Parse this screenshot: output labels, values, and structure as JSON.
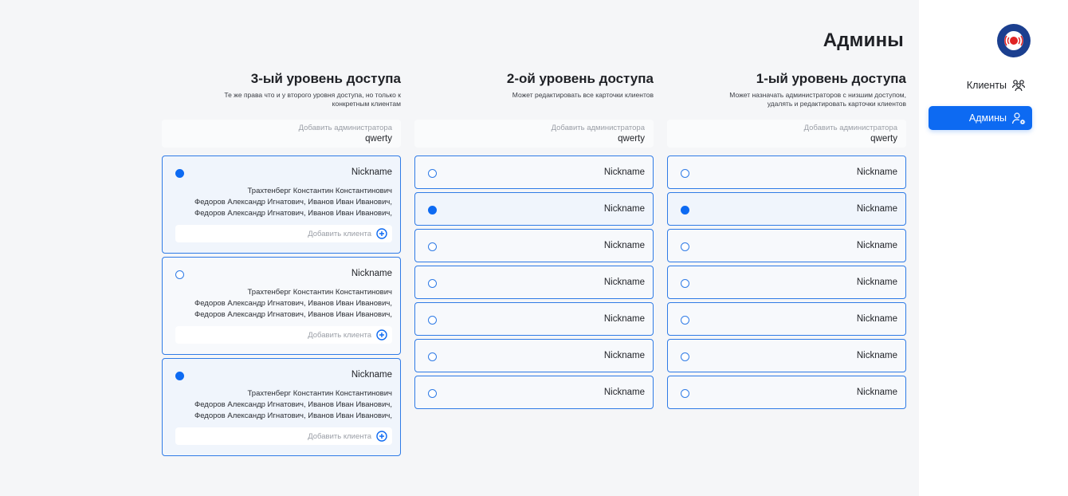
{
  "page": {
    "title": "Админы"
  },
  "nav": {
    "clients_label": "Клиенты",
    "admins_label": "Админы"
  },
  "colors": {
    "accent": "#0d6af2",
    "card_border": "#2f7be6",
    "background": "#f5f6f8"
  },
  "columns": [
    {
      "title": "3-ый уровень доступа",
      "desc_line1": "Те же права что и у второго уровня доступа, но только к",
      "desc_line2": "конкретным клиентам",
      "add_label": "Добавить администратора",
      "add_value": "qwerty",
      "cards": [
        {
          "nickname": "Nickname",
          "selected": true,
          "line1": "Трахтенберг Константин Константинович",
          "line2": "Федоров Александр Игнатович, Иванов Иван Иванович,",
          "line3": "Федоров Александр Игнатович, Иванов Иван Иванович,",
          "add_client": "Добавить клиента"
        },
        {
          "nickname": "Nickname",
          "selected": false,
          "line1": "Трахтенберг Константин Константинович",
          "line2": "Федоров Александр Игнатович, Иванов Иван Иванович,",
          "line3": "Федоров Александр Игнатович, Иванов Иван Иванович,",
          "add_client": "Добавить клиента"
        },
        {
          "nickname": "Nickname",
          "selected": true,
          "line1": "Трахтенберг Константин Константинович",
          "line2": "Федоров Александр Игнатович, Иванов Иван Иванович,",
          "line3": "Федоров Александр Игнатович, Иванов Иван Иванович,",
          "add_client": "Добавить клиента"
        }
      ]
    },
    {
      "title": "2-ой уровень доступа",
      "desc_line1": "Может редактировать все карточки клиентов",
      "desc_line2": "",
      "add_label": "Добавить администратора",
      "add_value": "qwerty",
      "cards": [
        {
          "nickname": "Nickname",
          "selected": false
        },
        {
          "nickname": "Nickname",
          "selected": true
        },
        {
          "nickname": "Nickname",
          "selected": false
        },
        {
          "nickname": "Nickname",
          "selected": false
        },
        {
          "nickname": "Nickname",
          "selected": false
        },
        {
          "nickname": "Nickname",
          "selected": false
        },
        {
          "nickname": "Nickname",
          "selected": false
        }
      ]
    },
    {
      "title": "1-ый уровень доступа",
      "desc_line1": "Может назначать администраторов с низшим доступом,",
      "desc_line2": "удалять и редактировать карточки клиентов",
      "add_label": "Добавить администратора",
      "add_value": "qwerty",
      "cards": [
        {
          "nickname": "Nickname",
          "selected": false
        },
        {
          "nickname": "Nickname",
          "selected": true
        },
        {
          "nickname": "Nickname",
          "selected": false
        },
        {
          "nickname": "Nickname",
          "selected": false
        },
        {
          "nickname": "Nickname",
          "selected": false
        },
        {
          "nickname": "Nickname",
          "selected": false
        },
        {
          "nickname": "Nickname",
          "selected": false
        }
      ]
    }
  ]
}
